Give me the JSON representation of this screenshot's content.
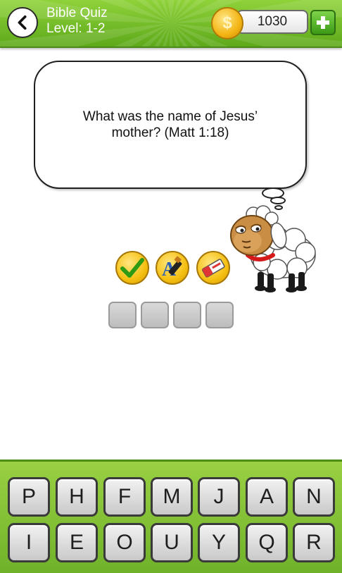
{
  "header": {
    "title": "Bible Quiz",
    "level": "Level: 1-2",
    "coins": "1030"
  },
  "icons": {
    "back": "chevron-left-icon",
    "coin": "coin-icon",
    "add": "plus-icon",
    "hint_reveal": "checkmark-icon",
    "hint_letter": "letter-pen-icon",
    "hint_remove": "eraser-icon",
    "mascot": "sheep-mascot"
  },
  "question": {
    "text": "What was the name of Jesus’ mother? (Matt 1:18)"
  },
  "answer": {
    "slots": [
      "",
      "",
      "",
      ""
    ]
  },
  "keyboard": {
    "row1": [
      "P",
      "H",
      "F",
      "M",
      "J",
      "A",
      "N"
    ],
    "row2": [
      "I",
      "E",
      "O",
      "U",
      "Y",
      "Q",
      "R"
    ]
  },
  "colors": {
    "header_green": "#7cc130",
    "coin_gold": "#f3b414",
    "plus_green": "#3c9a16",
    "keyboard_green": "#84c13a"
  }
}
